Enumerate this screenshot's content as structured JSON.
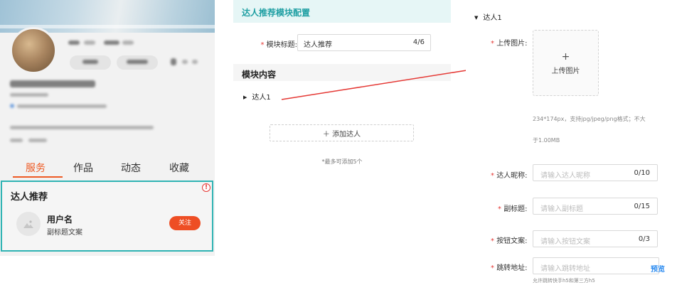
{
  "preview": {
    "tabs": [
      "服务",
      "作品",
      "动态",
      "收藏"
    ],
    "active_tab": 0,
    "accent_color": "#ee5a24",
    "card": {
      "title": "达人推荐",
      "warning_icon": "exclamation-circle-icon",
      "user_name": "用户名",
      "user_subtitle": "副标题文案",
      "follow_label": "关注"
    }
  },
  "config": {
    "header_title": "达人推荐模块配置",
    "module_title_label": "模块标题:",
    "module_title_value": "达人推荐",
    "module_title_count": "4/6",
    "content_section_title": "模块内容",
    "tree_item": "达人1",
    "add_button_label": "＋ 添加达人",
    "add_hint": "*最多可添加5个",
    "accent_color": "#1f9fa3"
  },
  "item_form": {
    "tree_item": "达人1",
    "upload_label": "上传图片:",
    "upload_plus": "+",
    "upload_text": "上传图片",
    "upload_help_line1": "234*174px，支持jpg/jpeg/png格式；不大",
    "upload_help_line2": "于1.00MB",
    "nickname_label": "达人昵称:",
    "nickname_placeholder": "请输入达人昵称",
    "nickname_count": "0/10",
    "subtitle_label": "副标题:",
    "subtitle_placeholder": "请输入副标题",
    "subtitle_count": "0/15",
    "button_text_label": "按钮文案:",
    "button_text_placeholder": "请输入按钮文案",
    "button_text_count": "0/3",
    "jump_url_label": "跳转地址:",
    "jump_url_placeholder": "请输入跳转地址",
    "jump_url_help": "允许跳转快手h5和第三方h5",
    "preview_link": "预览",
    "link_color": "#2d8cf0"
  }
}
